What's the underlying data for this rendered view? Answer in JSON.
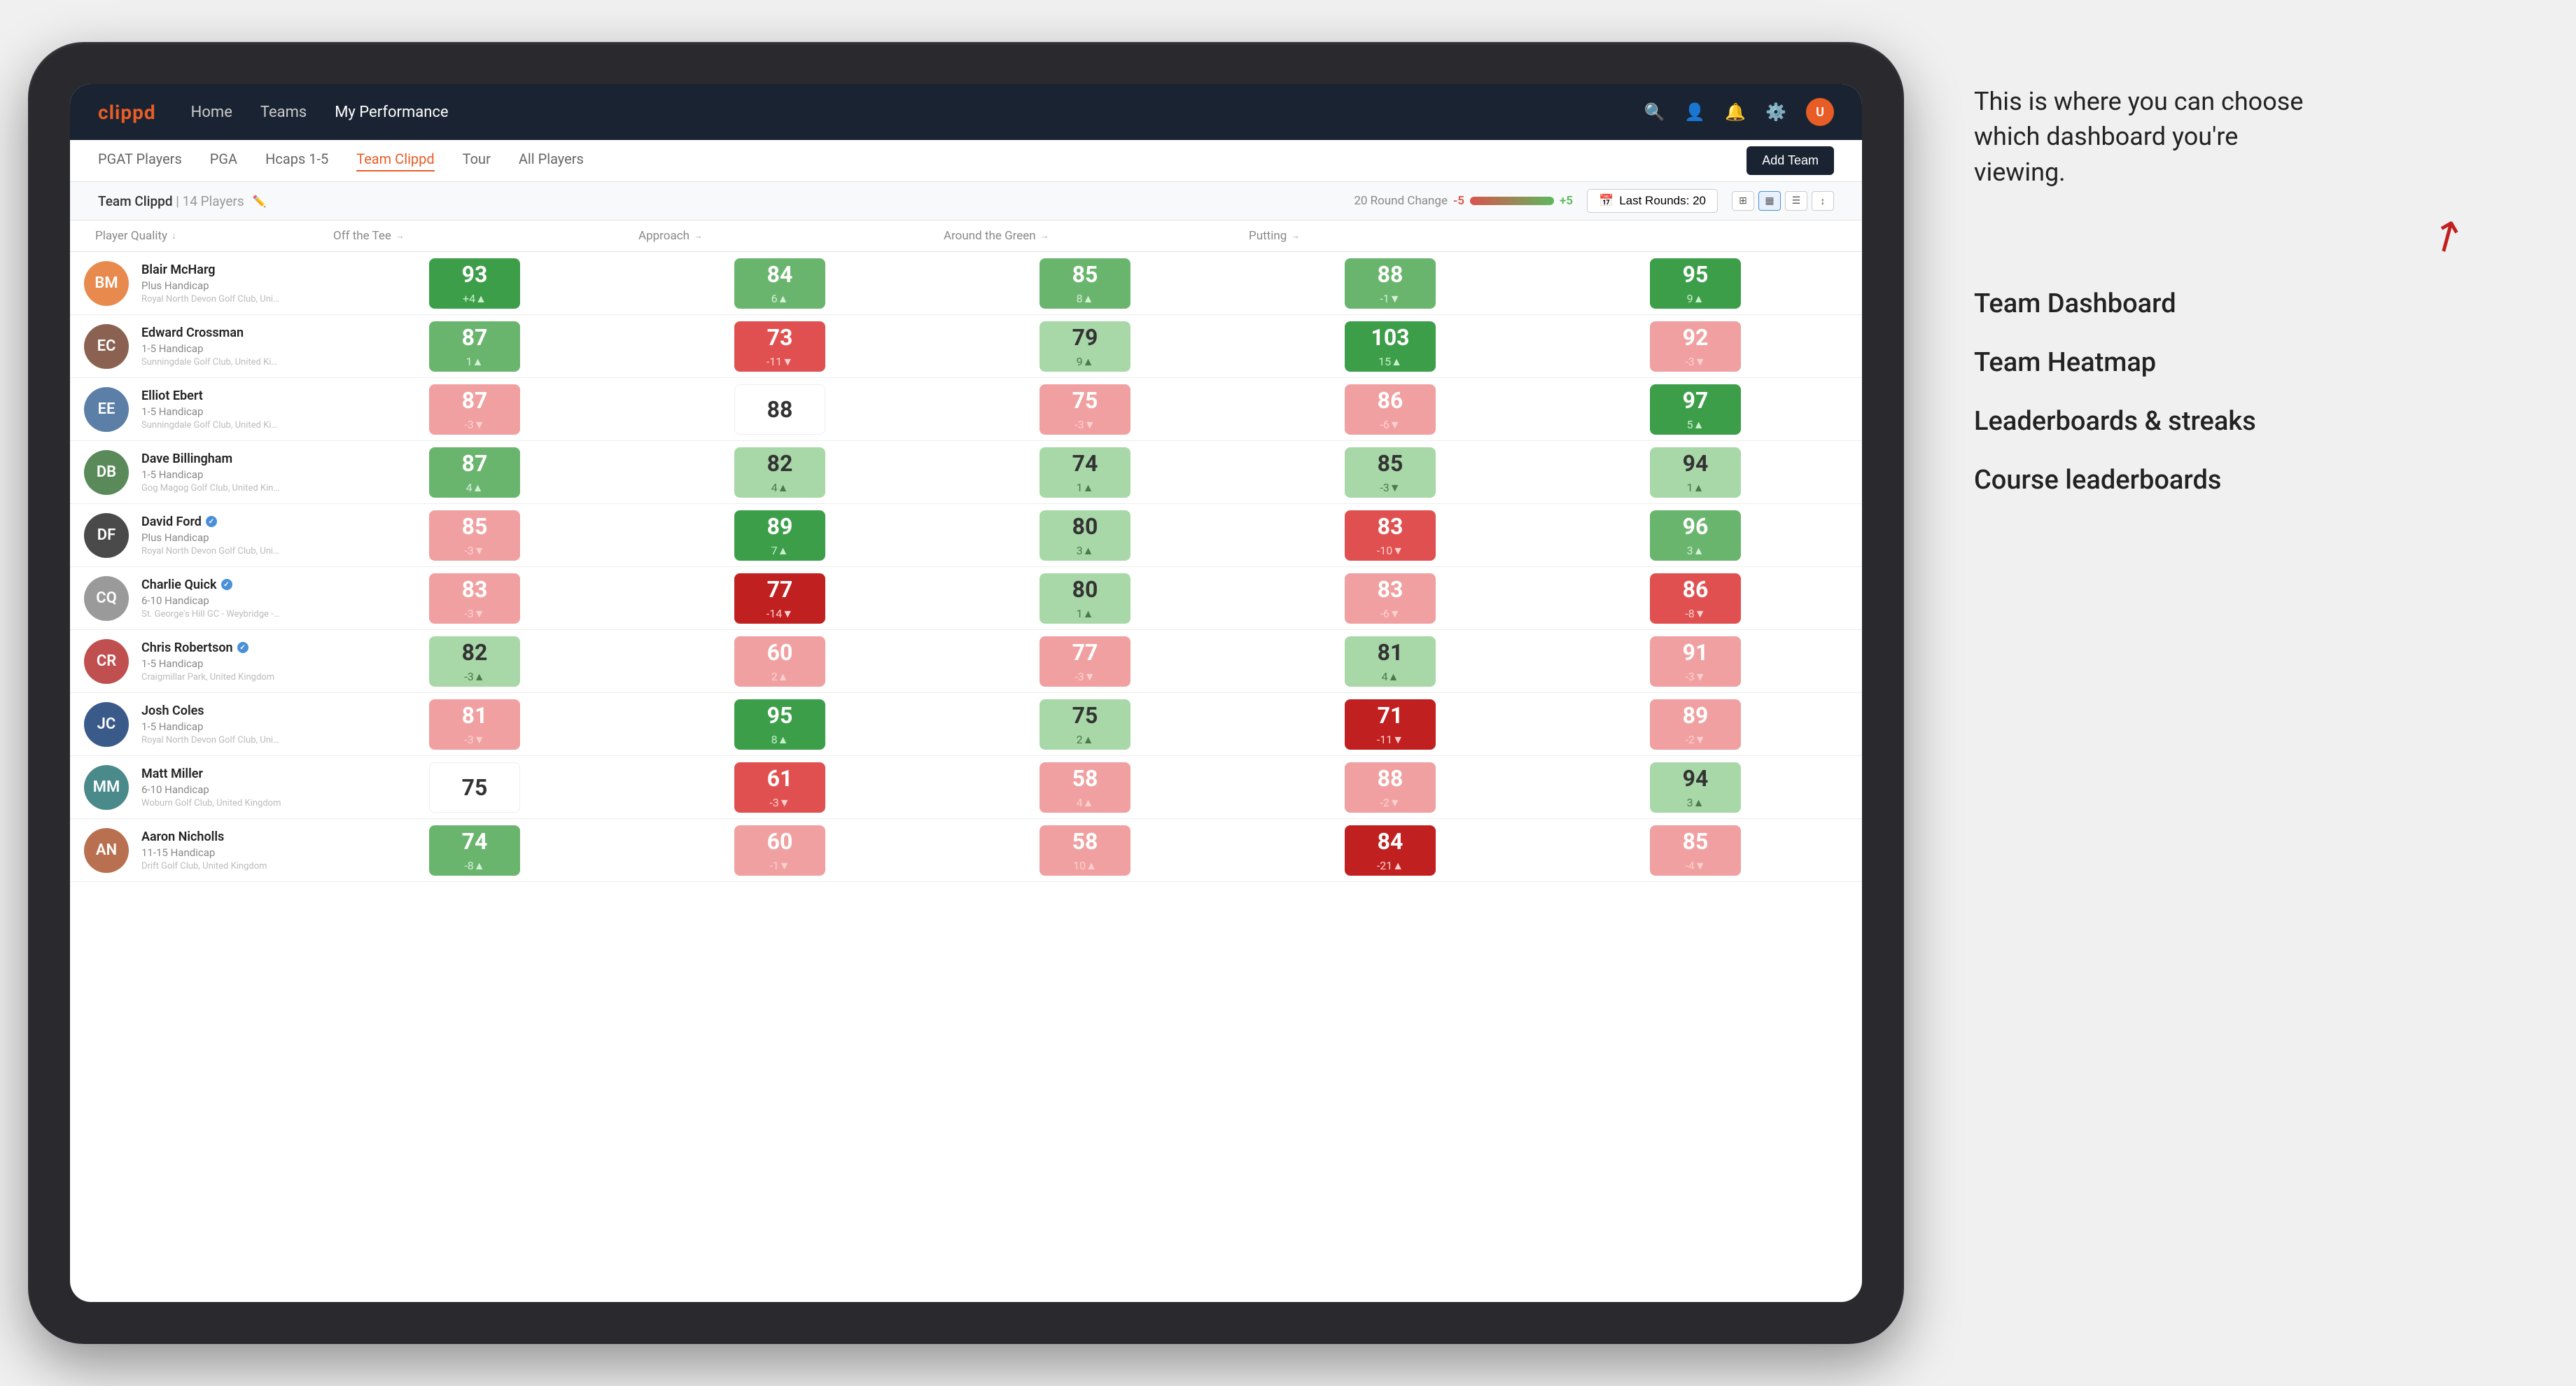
{
  "annotation": {
    "description": "This is where you can choose which dashboard you're viewing.",
    "items": [
      "Team Dashboard",
      "Team Heatmap",
      "Leaderboards & streaks",
      "Course leaderboards"
    ]
  },
  "nav": {
    "logo": "clippd",
    "links": [
      "Home",
      "Teams",
      "My Performance"
    ],
    "active_link": "My Performance"
  },
  "sub_tabs": {
    "tabs": [
      "PGAT Players",
      "PGA",
      "Hcaps 1-5",
      "Team Clippd",
      "Tour",
      "All Players"
    ],
    "active": "Team Clippd",
    "add_team_label": "Add Team"
  },
  "team_header": {
    "title": "Team Clippd",
    "separator": "|",
    "count": "14 Players",
    "round_change_label": "20 Round Change",
    "change_neg": "-5",
    "change_pos": "+5",
    "last_rounds_label": "Last Rounds:",
    "last_rounds_value": "20"
  },
  "columns": {
    "headers": [
      "Player Quality ↓",
      "Off the Tee →",
      "Approach →",
      "Around the Green →",
      "Putting →"
    ]
  },
  "players": [
    {
      "name": "Blair McHarg",
      "handicap": "Plus Handicap",
      "club": "Royal North Devon Golf Club, United Kingdom",
      "avatar_color": "av-orange",
      "initials": "BM",
      "scores": [
        {
          "value": 93,
          "change": "+4▲",
          "bg": "bg-green-dark"
        },
        {
          "value": 84,
          "change": "6▲",
          "bg": "bg-green-mid"
        },
        {
          "value": 85,
          "change": "8▲",
          "bg": "bg-green-mid"
        },
        {
          "value": 88,
          "change": "-1▼",
          "bg": "bg-green-mid"
        },
        {
          "value": 95,
          "change": "9▲",
          "bg": "bg-green-dark"
        }
      ]
    },
    {
      "name": "Edward Crossman",
      "handicap": "1-5 Handicap",
      "club": "Sunningdale Golf Club, United Kingdom",
      "avatar_color": "av-brown",
      "initials": "EC",
      "scores": [
        {
          "value": 87,
          "change": "1▲",
          "bg": "bg-green-mid"
        },
        {
          "value": 73,
          "change": "-11▼",
          "bg": "bg-red-mid"
        },
        {
          "value": 79,
          "change": "9▲",
          "bg": "bg-green-light"
        },
        {
          "value": 103,
          "change": "15▲",
          "bg": "bg-green-dark"
        },
        {
          "value": 92,
          "change": "-3▼",
          "bg": "bg-red-light"
        }
      ]
    },
    {
      "name": "Elliot Ebert",
      "handicap": "1-5 Handicap",
      "club": "Sunningdale Golf Club, United Kingdom",
      "avatar_color": "av-blue",
      "initials": "EE",
      "scores": [
        {
          "value": 87,
          "change": "-3▼",
          "bg": "bg-red-light"
        },
        {
          "value": 88,
          "change": "",
          "bg": "bg-white"
        },
        {
          "value": 75,
          "change": "-3▼",
          "bg": "bg-red-light"
        },
        {
          "value": 86,
          "change": "-6▼",
          "bg": "bg-red-light"
        },
        {
          "value": 97,
          "change": "5▲",
          "bg": "bg-green-dark"
        }
      ]
    },
    {
      "name": "Dave Billingham",
      "handicap": "1-5 Handicap",
      "club": "Gog Magog Golf Club, United Kingdom",
      "avatar_color": "av-green",
      "initials": "DB",
      "scores": [
        {
          "value": 87,
          "change": "4▲",
          "bg": "bg-green-mid"
        },
        {
          "value": 82,
          "change": "4▲",
          "bg": "bg-green-light"
        },
        {
          "value": 74,
          "change": "1▲",
          "bg": "bg-green-light"
        },
        {
          "value": 85,
          "change": "-3▼",
          "bg": "bg-green-light"
        },
        {
          "value": 94,
          "change": "1▲",
          "bg": "bg-green-light"
        }
      ]
    },
    {
      "name": "David Ford",
      "handicap": "Plus Handicap",
      "club": "Royal North Devon Golf Club, United Kingdom",
      "avatar_color": "av-dark",
      "initials": "DF",
      "badge": true,
      "scores": [
        {
          "value": 85,
          "change": "-3▼",
          "bg": "bg-red-light"
        },
        {
          "value": 89,
          "change": "7▲",
          "bg": "bg-green-dark"
        },
        {
          "value": 80,
          "change": "3▲",
          "bg": "bg-green-light"
        },
        {
          "value": 83,
          "change": "-10▼",
          "bg": "bg-red-mid"
        },
        {
          "value": 96,
          "change": "3▲",
          "bg": "bg-green-mid"
        }
      ]
    },
    {
      "name": "Charlie Quick",
      "handicap": "6-10 Handicap",
      "club": "St. George's Hill GC - Weybridge - Surrey, Uni...",
      "avatar_color": "av-grey",
      "initials": "CQ",
      "badge": true,
      "scores": [
        {
          "value": 83,
          "change": "-3▼",
          "bg": "bg-red-light"
        },
        {
          "value": 77,
          "change": "-14▼",
          "bg": "bg-red-dark"
        },
        {
          "value": 80,
          "change": "1▲",
          "bg": "bg-green-light"
        },
        {
          "value": 83,
          "change": "-6▼",
          "bg": "bg-red-light"
        },
        {
          "value": 86,
          "change": "-8▼",
          "bg": "bg-red-mid"
        }
      ]
    },
    {
      "name": "Chris Robertson",
      "handicap": "1-5 Handicap",
      "club": "Craigmillar Park, United Kingdom",
      "avatar_color": "av-red",
      "initials": "CR",
      "badge": true,
      "scores": [
        {
          "value": 82,
          "change": "-3▲",
          "bg": "bg-green-light"
        },
        {
          "value": 60,
          "change": "2▲",
          "bg": "bg-red-light"
        },
        {
          "value": 77,
          "change": "-3▼",
          "bg": "bg-red-light"
        },
        {
          "value": 81,
          "change": "4▲",
          "bg": "bg-green-light"
        },
        {
          "value": 91,
          "change": "-3▼",
          "bg": "bg-red-light"
        }
      ]
    },
    {
      "name": "Josh Coles",
      "handicap": "1-5 Handicap",
      "club": "Royal North Devon Golf Club, United Kingdom",
      "avatar_color": "av-navy",
      "initials": "JC",
      "scores": [
        {
          "value": 81,
          "change": "-3▼",
          "bg": "bg-red-light"
        },
        {
          "value": 95,
          "change": "8▲",
          "bg": "bg-green-dark"
        },
        {
          "value": 75,
          "change": "2▲",
          "bg": "bg-green-light"
        },
        {
          "value": 71,
          "change": "-11▼",
          "bg": "bg-red-dark"
        },
        {
          "value": 89,
          "change": "-2▼",
          "bg": "bg-red-light"
        }
      ]
    },
    {
      "name": "Matt Miller",
      "handicap": "6-10 Handicap",
      "club": "Woburn Golf Club, United Kingdom",
      "avatar_color": "av-teal",
      "initials": "MM",
      "scores": [
        {
          "value": 75,
          "change": "",
          "bg": "bg-white"
        },
        {
          "value": 61,
          "change": "-3▼",
          "bg": "bg-red-mid"
        },
        {
          "value": 58,
          "change": "4▲",
          "bg": "bg-red-light"
        },
        {
          "value": 88,
          "change": "-2▼",
          "bg": "bg-red-light"
        },
        {
          "value": 94,
          "change": "3▲",
          "bg": "bg-green-light"
        }
      ]
    },
    {
      "name": "Aaron Nicholls",
      "handicap": "11-15 Handicap",
      "club": "Drift Golf Club, United Kingdom",
      "avatar_color": "av-warm",
      "initials": "AN",
      "scores": [
        {
          "value": 74,
          "change": "-8▲",
          "bg": "bg-green-mid"
        },
        {
          "value": 60,
          "change": "-1▼",
          "bg": "bg-red-light"
        },
        {
          "value": 58,
          "change": "10▲",
          "bg": "bg-red-light"
        },
        {
          "value": 84,
          "change": "-21▲",
          "bg": "bg-red-dark"
        },
        {
          "value": 85,
          "change": "-4▼",
          "bg": "bg-red-light"
        }
      ]
    }
  ]
}
